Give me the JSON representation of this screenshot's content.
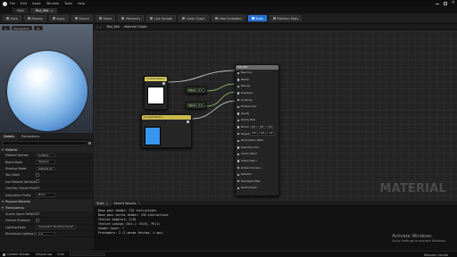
{
  "menu": {
    "items": [
      "File",
      "Edit",
      "Asset",
      "Window",
      "Tools",
      "Help"
    ]
  },
  "tabs": [
    {
      "label": "Main",
      "active": false
    },
    {
      "label": "Test_Mat",
      "active": true
    }
  ],
  "toolbar": {
    "save": "Save",
    "browse": "Browse",
    "apply": "Apply",
    "search": "Search",
    "home": "Home",
    "hierarchy": "Hierarchy",
    "live_update": "Live Update",
    "clean_graph": "Clean Graph",
    "hide_unrelated": "Hide Unrelated",
    "stats": "Stats",
    "platform_stats": "Platform Stats"
  },
  "viewport": {
    "perspective": "Perspective",
    "lit": "Lit"
  },
  "details": {
    "tabs": [
      "Details",
      "Parameters"
    ],
    "sections": {
      "material": "Material",
      "physical": "Physical Material",
      "translucency": "Translucency"
    },
    "rows": [
      {
        "label": "Material Domain",
        "value": "Surface",
        "type": "select"
      },
      {
        "label": "Blend Mode",
        "value": "Opaque",
        "type": "select"
      },
      {
        "label": "Shading Model",
        "value": "Default Lit",
        "type": "select"
      },
      {
        "label": "Two Sided",
        "value": "",
        "type": "check"
      },
      {
        "label": "Use Material Attributes",
        "value": "",
        "type": "check"
      },
      {
        "label": "Cast Ray Traced Shadows",
        "value": "",
        "type": "check"
      },
      {
        "label": "Subsurface Profile",
        "value": "None",
        "type": "select"
      }
    ],
    "physical_rows": [
      {
        "label": "Screen Space Reflections",
        "value": "",
        "type": "check"
      },
      {
        "label": "Contact Shadows",
        "value": "",
        "type": "check"
      },
      {
        "label": "Lighting Mode",
        "value": "Volumetric NonDirectional",
        "type": "select"
      },
      {
        "label": "Directional Lighting Intensity",
        "value": "1.0",
        "type": "number"
      }
    ]
  },
  "graph": {
    "tab_label": "Material Graph",
    "breadcrumb": "Test_Mat",
    "watermark": "MATERIAL",
    "main_node": {
      "title": "Test_Mat",
      "pins": [
        "Base Color",
        "Metallic",
        "Specular",
        "Roughness",
        "Anisotropy",
        "Emissive Color",
        "Opacity",
        "Opacity Mask",
        "Normal",
        "Tangent",
        "World Position Offset",
        "Subsurface Color",
        "Custom Data 0",
        "Custom Data 1",
        "Ambient Occlusion",
        "Refraction",
        "Pixel Depth Offset",
        "Shading Model"
      ]
    },
    "vec3_node": {
      "title": "Constant3Vector",
      "value": "0.0"
    },
    "const_nodes": [
      {
        "label": "Value",
        "value": "0.5"
      },
      {
        "label": "Value",
        "value": "0.8"
      }
    ],
    "vec4_node": {
      "title": "Constant4Vector"
    },
    "numeric_pins": [
      {
        "label": "Normal",
        "values": [
          "0.0",
          "0.0",
          "1.0"
        ]
      },
      {
        "label": "Tangent",
        "values": [
          "0.0",
          "0.0",
          "1.0"
        ]
      },
      {
        "label": "Subsurface",
        "values": [
          "0.0",
          "0.0",
          "1.0"
        ]
      }
    ]
  },
  "log": {
    "tabs": [
      "Stats",
      "Search Results"
    ],
    "lines": [
      "Base pass shader: 213 instructions",
      "Base pass vertex shader: 135 instructions",
      "Texture samplers: 2/16",
      "Texture Lookups (Est.): VS(0), PS(1)",
      "Shader Count: 7",
      "Preshaders: 2 (2 param fetches, 4 ops)"
    ]
  },
  "activate": {
    "title": "Activate Windows",
    "subtitle": "Go to Settings to activate Windows."
  },
  "status": {
    "content_drawer": "Content Drawer",
    "output_log": "Output Log",
    "cmd": "Cmd",
    "source_control": "Revision Control"
  },
  "colors": {
    "accent": "#1f6fd4",
    "vec3_preview": "#ffffff",
    "vec4_preview": "#3a95f0",
    "graph_bg": "#242424"
  }
}
